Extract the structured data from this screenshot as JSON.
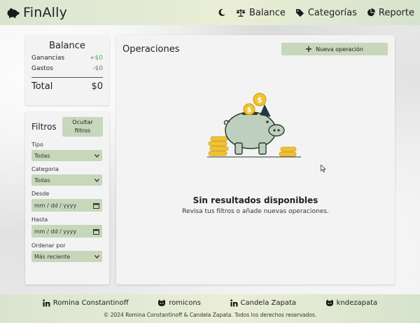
{
  "app": {
    "name": "FinAlly"
  },
  "nav": {
    "theme_icon": "moon-icon",
    "items": [
      {
        "label": "Balance",
        "icon": "scale-icon"
      },
      {
        "label": "Categorías",
        "icon": "tag-icon"
      },
      {
        "label": "Reporte",
        "icon": "pie-chart-icon"
      }
    ]
  },
  "balance": {
    "title": "Balance",
    "income_label": "Ganancias",
    "income_value": "+$0",
    "expense_label": "Gastos",
    "expense_value": "-$0",
    "total_label": "Total",
    "total_value": "$0"
  },
  "filters": {
    "title": "Filtros",
    "toggle_label": "Ocultar filtros",
    "type_label": "Tipo",
    "type_value": "Todas",
    "category_label": "Categoria",
    "category_value": "Todas",
    "from_label": "Desde",
    "from_placeholder": "mm / dd / yyyy",
    "to_label": "Hasta",
    "to_placeholder": "mm / dd / yyyy",
    "order_label": "Ordenar por",
    "order_value": "Más reciente"
  },
  "operations": {
    "title": "Operaciones",
    "new_button": "Nueva operación",
    "empty_title": "Sin resultados disponibles",
    "empty_subtitle": "Revisa tus filtros o añade nuevas operaciones."
  },
  "footer": {
    "links": [
      {
        "label": "Romina Constantinoff",
        "icon": "linkedin-icon"
      },
      {
        "label": "romicons",
        "icon": "github-icon"
      },
      {
        "label": "Candela Zapata",
        "icon": "linkedin-icon"
      },
      {
        "label": "kndezapata",
        "icon": "github-icon"
      }
    ],
    "copyright": "© 2024 Romina Constantinoff & Candela Zapata. Todos los derechos reservados."
  },
  "colors": {
    "accent": "#c6d7ba",
    "income": "#5aa85e",
    "coin": "#f2c232",
    "piggy": "#bfcfbe"
  }
}
